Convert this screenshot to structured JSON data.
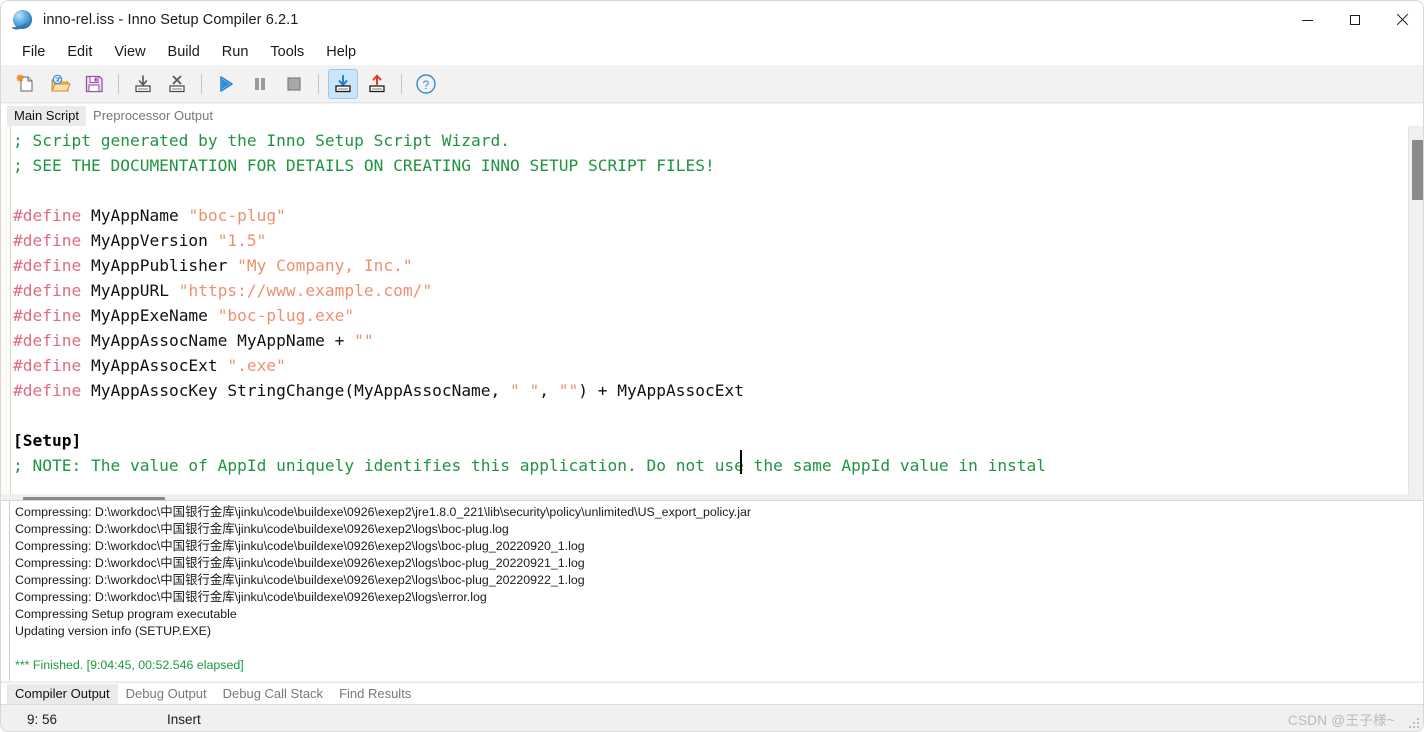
{
  "window": {
    "title": "inno-rel.iss - Inno Setup Compiler 6.2.1",
    "app_icon": "inno-setup-globe-icon",
    "controls": {
      "minimize": "minimize-icon",
      "maximize": "maximize-icon",
      "close": "close-icon"
    }
  },
  "menubar": {
    "items": [
      "File",
      "Edit",
      "View",
      "Build",
      "Run",
      "Tools",
      "Help"
    ]
  },
  "toolbar": {
    "buttons": [
      {
        "name": "new-file-icon",
        "title": "New"
      },
      {
        "name": "open-file-icon",
        "title": "Open"
      },
      {
        "name": "save-file-icon",
        "title": "Save"
      },
      {
        "name": "separator",
        "title": ""
      },
      {
        "name": "print-icon",
        "title": "Print"
      },
      {
        "name": "delete-line-icon",
        "title": "Delete"
      },
      {
        "name": "separator",
        "title": ""
      },
      {
        "name": "run-icon",
        "title": "Run"
      },
      {
        "name": "pause-icon",
        "title": "Pause"
      },
      {
        "name": "stop-icon",
        "title": "Stop"
      },
      {
        "name": "separator",
        "title": ""
      },
      {
        "name": "compile-icon",
        "title": "Compile"
      },
      {
        "name": "upload-icon",
        "title": "Publish"
      },
      {
        "name": "separator",
        "title": ""
      },
      {
        "name": "help-icon",
        "title": "Help"
      }
    ]
  },
  "editor_tabs": {
    "items": [
      {
        "label": "Main Script",
        "selected": true
      },
      {
        "label": "Preprocessor Output",
        "selected": false
      }
    ]
  },
  "editor": {
    "caret_visible": true,
    "lines": [
      {
        "t": "comment",
        "text": "; Script generated by the Inno Setup Script Wizard."
      },
      {
        "t": "comment",
        "text": "; SEE THE DOCUMENTATION FOR DETAILS ON CREATING INNO SETUP SCRIPT FILES!"
      },
      {
        "t": "blank",
        "text": ""
      },
      {
        "t": "define",
        "kw": "#define",
        "name": " MyAppName ",
        "str": "\"boc-plug\"",
        "tail": ""
      },
      {
        "t": "define",
        "kw": "#define",
        "name": " MyAppVersion ",
        "str": "\"1.5\"",
        "tail": ""
      },
      {
        "t": "define",
        "kw": "#define",
        "name": " MyAppPublisher ",
        "str": "\"My Company, Inc.\"",
        "tail": ""
      },
      {
        "t": "define",
        "kw": "#define",
        "name": " MyAppURL ",
        "str": "\"https://www.example.com/\"",
        "tail": ""
      },
      {
        "t": "define",
        "kw": "#define",
        "name": " MyAppExeName ",
        "str": "\"boc-plug.exe\"",
        "tail": ""
      },
      {
        "t": "define",
        "kw": "#define",
        "name": " MyAppAssocName MyAppName + ",
        "str": "\"\"",
        "tail": ""
      },
      {
        "t": "define",
        "kw": "#define",
        "name": " MyAppAssocExt ",
        "str": "\".exe\"",
        "tail": ""
      },
      {
        "t": "assockey",
        "kw": "#define",
        "name": " MyAppAssocKey StringChange(MyAppAssocName, ",
        "s1": "\" \"",
        "mid": ", ",
        "s2": "\"\"",
        "tail": ") + MyAppAssocExt"
      },
      {
        "t": "blank",
        "text": ""
      },
      {
        "t": "section",
        "text": "[Setup]"
      },
      {
        "t": "comment",
        "text": "; NOTE: The value of AppId uniquely identifies this application. Do not use the same AppId value in instal"
      }
    ],
    "colors": {
      "comment": "#1f9441",
      "directive": "#e06b82",
      "string": "#f09070",
      "section": "#000000",
      "background": "#ffffff"
    },
    "scrollbars": {
      "vertical_thumb_top_pct": 4,
      "horizontal_thumb_left_pct": 2
    }
  },
  "output": {
    "lines": [
      {
        "kind": "normal",
        "text": "Compressing: D:\\workdoc\\中国银行金库\\jinku\\code\\buildexe\\0926\\exep2\\jre1.8.0_221\\lib\\security\\policy\\unlimited\\US_export_policy.jar"
      },
      {
        "kind": "normal",
        "text": "Compressing: D:\\workdoc\\中国银行金库\\jinku\\code\\buildexe\\0926\\exep2\\logs\\boc-plug.log"
      },
      {
        "kind": "normal",
        "text": "Compressing: D:\\workdoc\\中国银行金库\\jinku\\code\\buildexe\\0926\\exep2\\logs\\boc-plug_20220920_1.log"
      },
      {
        "kind": "normal",
        "text": "Compressing: D:\\workdoc\\中国银行金库\\jinku\\code\\buildexe\\0926\\exep2\\logs\\boc-plug_20220921_1.log"
      },
      {
        "kind": "normal",
        "text": "Compressing: D:\\workdoc\\中国银行金库\\jinku\\code\\buildexe\\0926\\exep2\\logs\\boc-plug_20220922_1.log"
      },
      {
        "kind": "normal",
        "text": "Compressing: D:\\workdoc\\中国银行金库\\jinku\\code\\buildexe\\0926\\exep2\\logs\\error.log"
      },
      {
        "kind": "normal",
        "text": "Compressing Setup program executable"
      },
      {
        "kind": "normal",
        "text": "Updating version info (SETUP.EXE)"
      },
      {
        "kind": "blank",
        "text": ""
      },
      {
        "kind": "finished",
        "text": "*** Finished.  [9:04:45, 00:52.546 elapsed]"
      }
    ]
  },
  "bottom_tabs": {
    "items": [
      {
        "label": "Compiler Output",
        "selected": true
      },
      {
        "label": "Debug Output",
        "selected": false
      },
      {
        "label": "Debug Call Stack",
        "selected": false
      },
      {
        "label": "Find Results",
        "selected": false
      }
    ]
  },
  "statusbar": {
    "position": "9: 56",
    "insert_mode": "Insert",
    "watermark": "CSDN @王子様~"
  }
}
